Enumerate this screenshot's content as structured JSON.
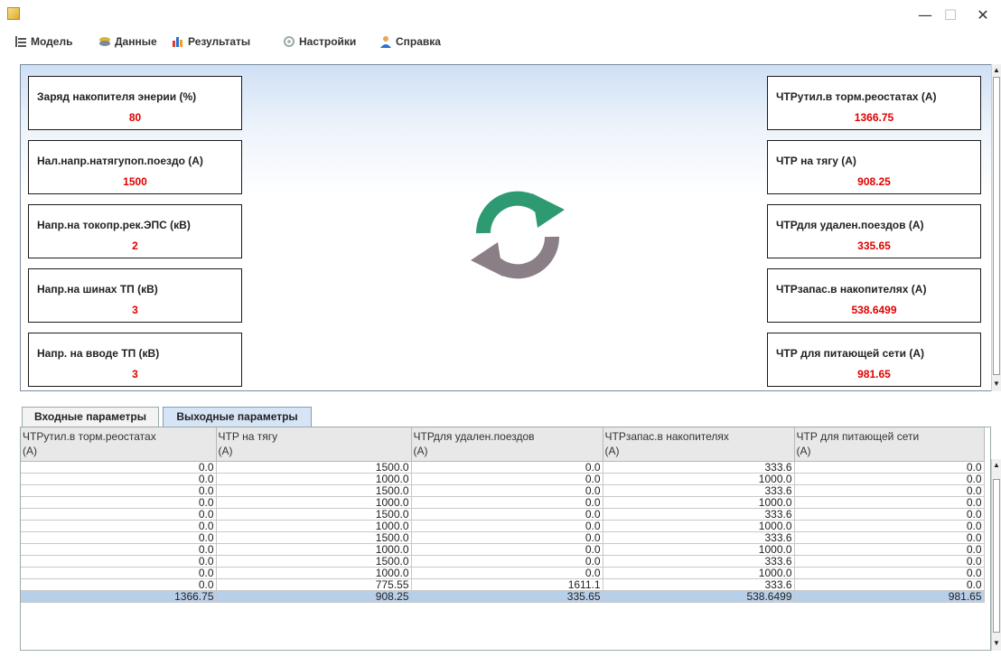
{
  "window": {
    "minimize_glyph": "—",
    "maximize_glyph": "☐",
    "close_glyph": "✕"
  },
  "menu": {
    "items": [
      {
        "label": "Модель",
        "icon": "model-icon"
      },
      {
        "label": "Данные",
        "icon": "data-icon"
      },
      {
        "label": "Результаты",
        "icon": "results-chart-icon"
      },
      {
        "label": "Настройки",
        "icon": "settings-icon"
      },
      {
        "label": "Справка",
        "icon": "help-user-icon"
      }
    ]
  },
  "inputs": [
    {
      "label": "Заряд накопителя энерии (%)",
      "value": "80"
    },
    {
      "label": "Нал.напр.натягупоп.поездо (А)",
      "value": "1500"
    },
    {
      "label": "Напр.на токопр.рек.ЭПС (кВ)",
      "value": "2"
    },
    {
      "label": "Напр.на шинах ТП (кВ)",
      "value": "3"
    },
    {
      "label": "Напр. на вводе ТП (кВ)",
      "value": "3"
    }
  ],
  "outputs": [
    {
      "label": "ЧТРутил.в торм.реостатах (А)",
      "value": "1366.75"
    },
    {
      "label": "ЧТР на тягу (А)",
      "value": "908.25"
    },
    {
      "label": "ЧТРдля удален.поездов (А)",
      "value": "335.65"
    },
    {
      "label": "ЧТРзапас.в накопителях (А)",
      "value": "538.6499"
    },
    {
      "label": "ЧТР для питающей сети (А)",
      "value": "981.65"
    }
  ],
  "colors": {
    "value_red": "#e00000",
    "refresh_green": "#2e9a72",
    "refresh_gray": "#8a7f86"
  },
  "tabs": [
    {
      "label": "Входные параметры",
      "active": false
    },
    {
      "label": "Выходные параметры",
      "active": true
    }
  ],
  "table": {
    "columns": [
      {
        "line1": "ЧТРутил.в торм.реостатах",
        "line2": "(А)"
      },
      {
        "line1": "ЧТР на тягу",
        "line2": "(А)"
      },
      {
        "line1": "ЧТРдля удален.поездов",
        "line2": "(А)"
      },
      {
        "line1": "ЧТРзапас.в накопителях",
        "line2": "(А)"
      },
      {
        "line1": "ЧТР для питающей сети",
        "line2": "(А)"
      }
    ],
    "rows": [
      [
        "0.0",
        "1500.0",
        "0.0",
        "333.6",
        "0.0"
      ],
      [
        "0.0",
        "1000.0",
        "0.0",
        "1000.0",
        "0.0"
      ],
      [
        "0.0",
        "1500.0",
        "0.0",
        "333.6",
        "0.0"
      ],
      [
        "0.0",
        "1000.0",
        "0.0",
        "1000.0",
        "0.0"
      ],
      [
        "0.0",
        "1500.0",
        "0.0",
        "333.6",
        "0.0"
      ],
      [
        "0.0",
        "1000.0",
        "0.0",
        "1000.0",
        "0.0"
      ],
      [
        "0.0",
        "1500.0",
        "0.0",
        "333.6",
        "0.0"
      ],
      [
        "0.0",
        "1000.0",
        "0.0",
        "1000.0",
        "0.0"
      ],
      [
        "0.0",
        "1500.0",
        "0.0",
        "333.6",
        "0.0"
      ],
      [
        "0.0",
        "1000.0",
        "0.0",
        "1000.0",
        "0.0"
      ],
      [
        "0.0",
        "775.55",
        "1611.1",
        "333.6",
        "0.0"
      ],
      [
        "1366.75",
        "908.25",
        "335.65",
        "538.6499",
        "981.65"
      ]
    ]
  }
}
